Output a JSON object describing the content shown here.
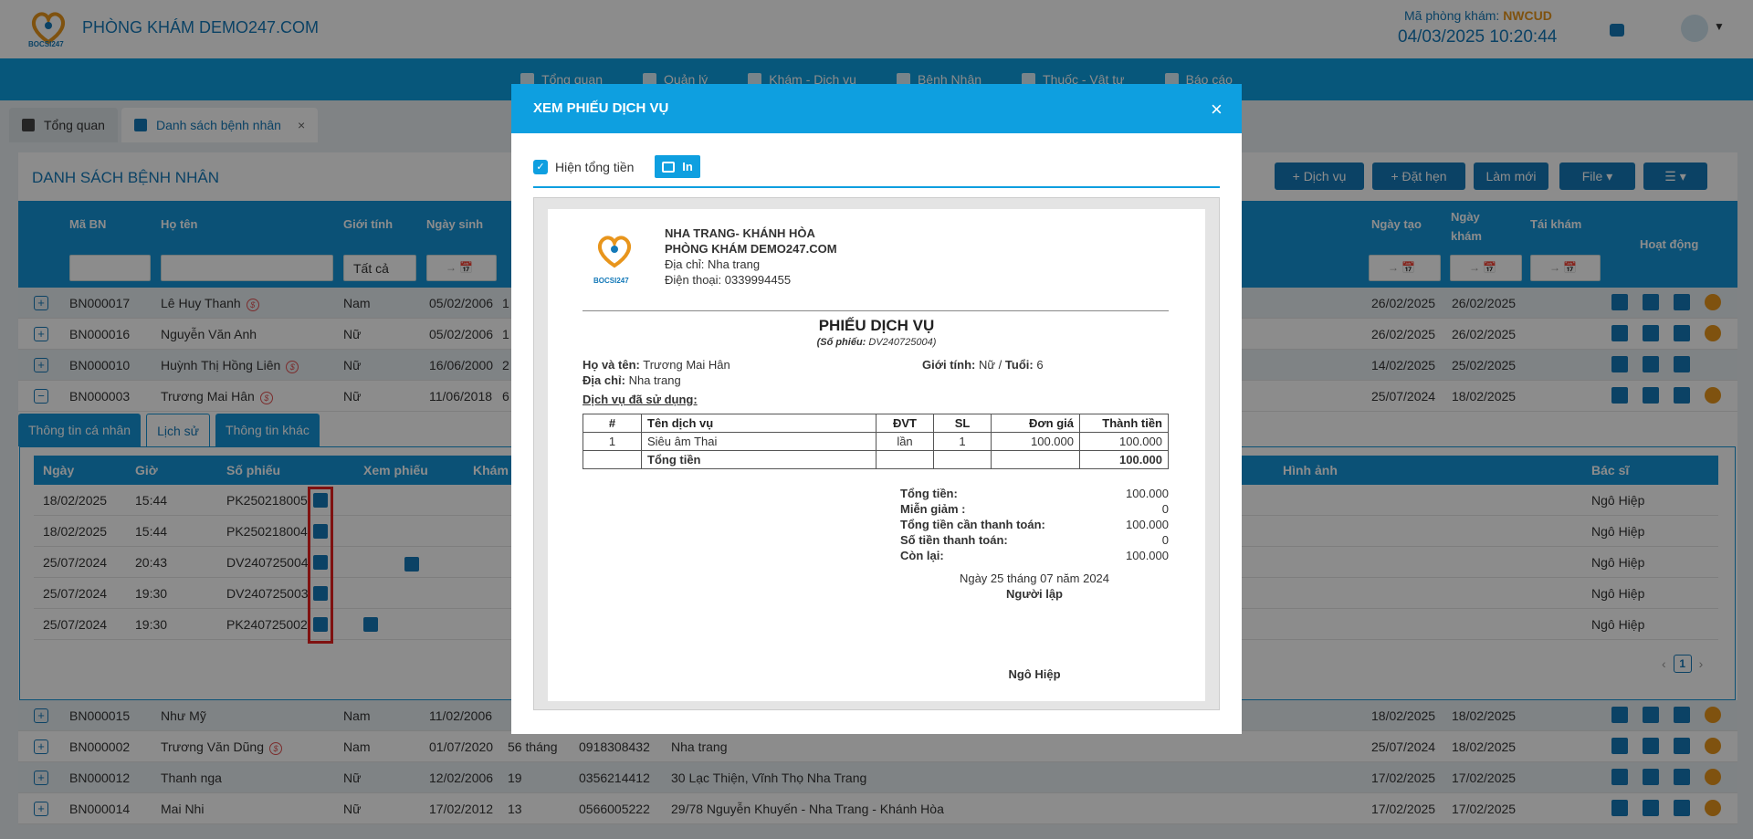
{
  "header": {
    "brand": "PHÒNG KHÁM DEMO247.COM",
    "logo_text": "BOCSI247",
    "clinic_code_label": "Mã phòng khám:",
    "clinic_code": "NWCUD",
    "datetime": "04/03/2025 10:20:44"
  },
  "nav": [
    "Tổng quan",
    "Quản lý",
    "Khám - Dịch vụ",
    "Bệnh Nhân",
    "Thuốc - Vật tư",
    "Báo cáo"
  ],
  "tabs": {
    "overview": "Tổng quan",
    "patients": "Danh sách bệnh nhân",
    "close": "×"
  },
  "page": {
    "title": "DANH SÁCH BỆNH NHÂN",
    "buttons": {
      "service": "+  Dịch vụ",
      "appointment": "+  Đặt hẹn",
      "refresh": "Làm mới",
      "file": "File ▾",
      "menu": "☰ ▾"
    }
  },
  "table": {
    "headers": {
      "ma_bn": "Mã BN",
      "ho_ten": "Họ tên",
      "gioi_tinh": "Giới tính",
      "ngay_sinh": "Ngày sinh",
      "ngay_tao": "Ngày tạo",
      "ngay_kham": "Ngày khám",
      "tai_kham": "Tái khám",
      "hoat_dong": "Hoạt động"
    },
    "gender_filter": "Tất cả",
    "date_filter": "→ 📅",
    "rows_top": [
      {
        "id": "BN000017",
        "name": "Lê Huy Thanh",
        "dollar": "$",
        "gender": "Nam",
        "dob": "05/02/2006",
        "extra": "1",
        "created": "26/02/2025",
        "visit": "26/02/2025"
      },
      {
        "id": "BN000016",
        "name": "Nguyễn Văn Anh",
        "dollar": "",
        "gender": "Nữ",
        "dob": "05/02/2006",
        "extra": "1",
        "created": "26/02/2025",
        "visit": "26/02/2025"
      },
      {
        "id": "BN000010",
        "name": "Huỳnh Thị Hồng Liên",
        "dollar": "$",
        "gender": "Nữ",
        "dob": "16/06/2000",
        "extra": "2",
        "created": "14/02/2025",
        "visit": "25/02/2025"
      },
      {
        "id": "BN000003",
        "name": "Trương Mai Hân",
        "dollar": "$",
        "gender": "Nữ",
        "dob": "11/06/2018",
        "extra": "6",
        "created": "25/07/2024",
        "visit": "18/02/2025"
      }
    ],
    "rows_bottom": [
      {
        "id": "BN000015",
        "name": "Như Mỹ",
        "dollar": "",
        "gender": "Nam",
        "dob": "11/02/2006",
        "age": "",
        "phone": "",
        "address": "",
        "created": "18/02/2025",
        "visit": "18/02/2025"
      },
      {
        "id": "BN000002",
        "name": "Trương Văn Dũng",
        "dollar": "$",
        "gender": "Nam",
        "dob": "01/07/2020",
        "age": "56 tháng",
        "phone": "0918308432",
        "address": "Nha trang",
        "created": "25/07/2024",
        "visit": "18/02/2025"
      },
      {
        "id": "BN000012",
        "name": "Thanh nga",
        "dollar": "",
        "gender": "Nữ",
        "dob": "12/02/2006",
        "age": "19",
        "phone": "0356214412",
        "address": "30 Lạc Thiện, Vĩnh Thọ Nha Trang",
        "created": "17/02/2025",
        "visit": "17/02/2025"
      },
      {
        "id": "BN000014",
        "name": "Mai Nhi",
        "dollar": "",
        "gender": "Nữ",
        "dob": "17/02/2012",
        "age": "13",
        "phone": "0566005222",
        "address": "29/78 Nguyễn Khuyến - Nha Trang - Khánh Hòa",
        "created": "17/02/2025",
        "visit": "17/02/2025"
      }
    ]
  },
  "subtabs": [
    "Thông tin cá nhân",
    "Lịch sử",
    "Thông tin khác"
  ],
  "history": {
    "headers": {
      "date": "Ngày",
      "time": "Giờ",
      "ticket": "Số phiếu",
      "view": "Xem phiếu",
      "exam": "Khám",
      "image": "Hình ảnh",
      "doctor": "Bác sĩ"
    },
    "rows": [
      {
        "date": "18/02/2025",
        "time": "15:44",
        "ticket": "PK250218005",
        "doctor": "Ngô Hiệp"
      },
      {
        "date": "18/02/2025",
        "time": "15:44",
        "ticket": "PK250218004",
        "doctor": "Ngô Hiệp"
      },
      {
        "date": "25/07/2024",
        "time": "20:43",
        "ticket": "DV240725004",
        "doctor": "Ngô Hiệp"
      },
      {
        "date": "25/07/2024",
        "time": "19:30",
        "ticket": "DV240725003",
        "doctor": "Ngô Hiệp"
      },
      {
        "date": "25/07/2024",
        "time": "19:30",
        "ticket": "PK240725002",
        "doctor": "Ngô Hiệp"
      }
    ],
    "pager": {
      "prev": "‹",
      "page": "1",
      "next": "›"
    }
  },
  "modal": {
    "title": "XEM PHIẾU DỊCH VỤ",
    "close": "×",
    "show_total_label": "Hiện tổng tiền",
    "show_total_checked": true,
    "print_label": "In",
    "receipt": {
      "clinic_region": "NHA TRANG- KHÁNH HÒA",
      "clinic_name": "PHÒNG KHÁM DEMO247.COM",
      "address": "Địa chỉ: Nha trang",
      "phone": "Điện thoại: 0339994455",
      "title": "PHIẾU DỊCH VỤ",
      "ticket_label": "(Số phiếu:",
      "ticket_no": "DV240725004)",
      "name_label": "Họ và tên:",
      "name": "Trương Mai Hân",
      "gender_label": "Giới tính:",
      "gender": "Nữ /",
      "age_label": "Tuổi:",
      "age": "6",
      "addr_label": "Địa chỉ:",
      "addr": "Nha trang",
      "used_label": "Dịch vụ đã sử dụng:",
      "cols": [
        "#",
        "Tên dịch vụ",
        "ĐVT",
        "SL",
        "Đơn giá",
        "Thành tiền"
      ],
      "items": [
        {
          "no": "1",
          "name": "Siêu âm Thai",
          "unit": "lần",
          "qty": "1",
          "price": "100.000",
          "amount": "100.000"
        }
      ],
      "total_row_label": "Tổng tiền",
      "total_row_value": "100.000",
      "summary": [
        {
          "label": "Tổng tiền:",
          "value": "100.000"
        },
        {
          "label": "Miễn giảm :",
          "value": "0"
        },
        {
          "label": "Tổng tiền cần thanh toán:",
          "value": "100.000"
        },
        {
          "label": "Số tiền thanh toán:",
          "value": "0"
        },
        {
          "label": "Còn lại:",
          "value": "100.000"
        }
      ],
      "date_line": "Ngày 25 tháng 07 năm 2024",
      "signer_label": "Người lập",
      "signer": "Ngô Hiệp"
    }
  }
}
